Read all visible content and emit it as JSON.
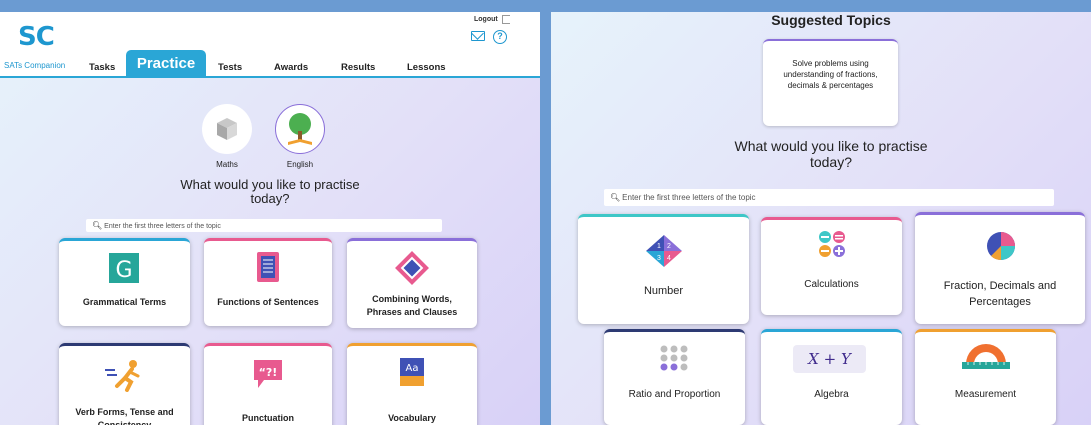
{
  "left": {
    "logo": "SC",
    "logo_sub": "SATs Companion",
    "logout": "Logout",
    "nav": {
      "tasks": "Tasks",
      "practice": "Practice",
      "tests": "Tests",
      "awards": "Awards",
      "results": "Results",
      "lessons": "Lessons"
    },
    "subjects": [
      {
        "label": "Maths"
      },
      {
        "label": "English"
      }
    ],
    "question": "What would you like to practise today?",
    "search_placeholder": "Enter the first three letters of the topic",
    "cards": [
      {
        "label": "Grammatical Terms",
        "icon": "g-letter-icon",
        "color": "#2aa6d6"
      },
      {
        "label": "Functions of Sentences",
        "icon": "document-icon",
        "color": "#e85a8f"
      },
      {
        "label": "Combining Words, Phrases and Clauses",
        "icon": "links-icon",
        "color": "#8a6fd9"
      },
      {
        "label": "Verb Forms, Tense and Consistency",
        "icon": "runner-icon",
        "color": "#2d3a73"
      },
      {
        "label": "Punctuation",
        "icon": "speech-bubble-icon",
        "color": "#e85a8f"
      },
      {
        "label": "Vocabulary",
        "icon": "aa-book-icon",
        "color": "#f0a030"
      }
    ]
  },
  "right": {
    "suggested_title": "Suggested Topics",
    "suggested_topic": "Solve problems using understanding of fractions, decimals & percentages",
    "question": "What would you like to practise today?",
    "search_placeholder": "Enter the first three letters of the topic",
    "cards": [
      {
        "label": "Number",
        "icon": "number-quadrant-icon",
        "color": "#3ec7c7"
      },
      {
        "label": "Calculations",
        "icon": "calculator-signs-icon",
        "color": "#e85a8f"
      },
      {
        "label": "Fraction, Decimals and Percentages",
        "icon": "pie-chart-icon",
        "color": "#8a6fd9"
      },
      {
        "label": "Ratio and Proportion",
        "icon": "dots-grid-icon",
        "color": "#2d3a73"
      },
      {
        "label": "Algebra",
        "icon": "algebra-icon",
        "algebra_text": "X + Y",
        "color": "#2aa6d6"
      },
      {
        "label": "Measurement",
        "icon": "protractor-ruler-icon",
        "color": "#f0a030"
      }
    ]
  }
}
